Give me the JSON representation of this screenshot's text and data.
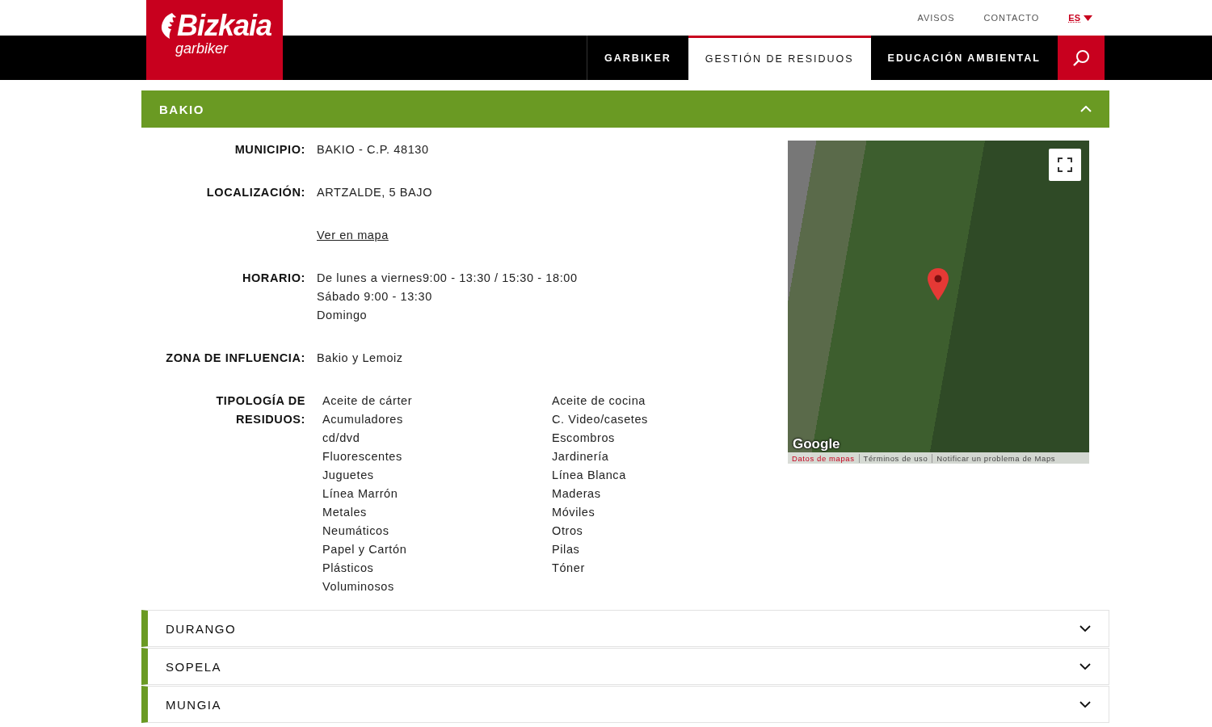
{
  "header": {
    "logo": {
      "brand": "Bizkaia",
      "sub": "garbiker"
    },
    "top_links": [
      "AVISOS",
      "CONTACTO"
    ],
    "language": "ES",
    "nav": [
      {
        "label": "GARBIKER",
        "selected": false
      },
      {
        "label": "GESTIÓN DE RESIDUOS",
        "selected": true
      },
      {
        "label": "EDUCACIÓN AMBIENTAL",
        "selected": false
      }
    ]
  },
  "sections": [
    {
      "title": "BAKIO",
      "expanded": true,
      "fields": [
        {
          "kind": "text",
          "label": "MUNICIPIO:",
          "value": "BAKIO - C.P. 48130"
        },
        {
          "kind": "text",
          "label": "LOCALIZACIÓN:",
          "value": "ARTZALDE, 5 BAJO"
        },
        {
          "kind": "link",
          "value": "Ver en mapa"
        },
        {
          "kind": "lines",
          "label": "HORARIO:",
          "lines": [
            "De lunes a viernes9:00 - 13:30 / 15:30 - 18:00",
            "Sábado 9:00 - 13:30",
            "Domingo"
          ]
        },
        {
          "kind": "text",
          "label": "ZONA DE INFLUENCIA:",
          "value": "Bakio y Lemoiz"
        },
        {
          "kind": "list",
          "label": "TIPOLOGÍA DE RESIDUOS:",
          "items": [
            "Aceite de cárter",
            "Aceite de cocina",
            "Acumuladores",
            "C. Video/casetes",
            "cd/dvd",
            "Escombros",
            "Fluorescentes",
            "Jardinería",
            "Juguetes",
            "Línea Blanca",
            "Línea Marrón",
            "Maderas",
            "Metales",
            "Móviles",
            "Neumáticos",
            "Otros",
            "Papel y Cartón",
            "Pilas",
            "Plásticos",
            "Tóner",
            "Voluminosos"
          ]
        }
      ],
      "map": {
        "logo": "Google",
        "links": [
          "Datos de mapas",
          "Términos de uso",
          "Notificar un problema de Maps"
        ]
      }
    },
    {
      "title": "DURANGO",
      "expanded": false
    },
    {
      "title": "SOPELA",
      "expanded": false
    },
    {
      "title": "MUNGIA",
      "expanded": false
    }
  ]
}
